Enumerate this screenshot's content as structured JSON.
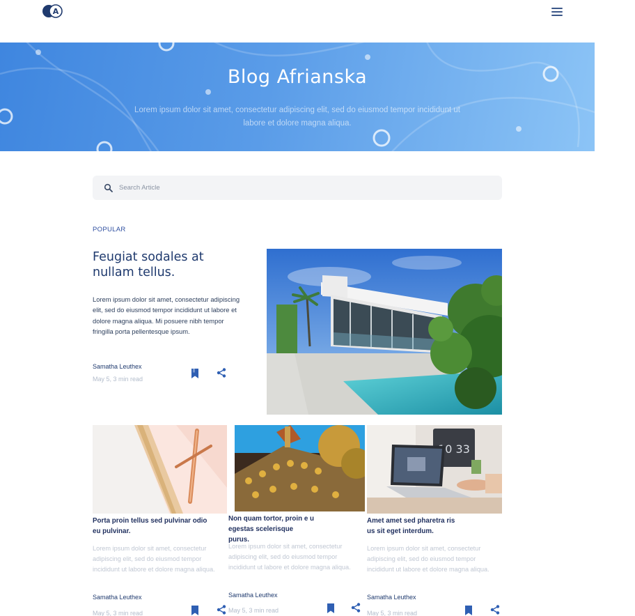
{
  "header": {
    "logo_letter": "A"
  },
  "hero": {
    "title": "Blog Afrianska",
    "subtitle": "Lorem ipsum dolor sit amet, consectetur adipiscing elit, sed do eiusmod tempor incididunt ut labore et dolore magna aliqua."
  },
  "search": {
    "placeholder": "Search Article",
    "value": ""
  },
  "popular": {
    "label": "POPULAR",
    "featured": {
      "title": "Feugiat sodales at nullam tellus.",
      "body": "Lorem ipsum dolor sit amet, consectetur adipiscing elit, sed do eiusmod tempor incididunt ut labore et dolore magna aliqua. Mi posuere nibh tempor fringilla porta pellentesque ipsum.",
      "author": "Samatha Leuthex",
      "date": "May 5, 3 min read"
    }
  },
  "cards": [
    {
      "title": "Porta proin tellus sed pulvinar odio eu pulvinar.",
      "body": "Lorem ipsum dolor sit amet, consectetur adipiscing elit, sed do eiusmod tempor incididunt ut labore et dolore magna aliqua.",
      "author": "Samatha Leuthex",
      "date": "May 5, 3 min read"
    },
    {
      "title": "Non quam tortor, proin e u egestas scelerisque purus.",
      "body": "Lorem ipsum dolor sit amet, consectetur adipiscing elit, sed do eiusmod tempor incididunt ut labore et dolore magna aliqua.",
      "author": "Samatha Leuthex",
      "date": "May 5, 3 min read"
    },
    {
      "title": "Amet amet sed pharetra ris us sit eget interdum.",
      "body": "Lorem ipsum dolor sit amet, consectetur adipiscing elit, sed do eiusmod tempor incididunt ut labore et dolore magna aliqua.",
      "author": "Samatha Leuthex",
      "date": "May 5, 3 min read"
    }
  ],
  "colors": {
    "accent": "#2f5fb3",
    "hero_start": "#3f86df",
    "hero_end": "#8cc4f6",
    "navy": "#1f3a6e"
  }
}
